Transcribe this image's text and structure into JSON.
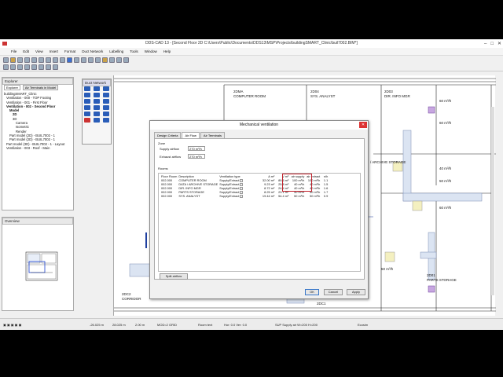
{
  "window": {
    "title": "DDS-CAD 13 - [Second Floor 2D C:\\Users\\Public\\Documents\\DDS13\\MSP\\Projects\\buildingSMART_Clinic\\buil7002.BIM*]",
    "minimize": "–",
    "maximize": "□",
    "close": "✕"
  },
  "menu": [
    "File",
    "Edit",
    "View",
    "Insert",
    "Format",
    "Duct Network",
    "Labelling",
    "Tools",
    "Window",
    "Help"
  ],
  "explorer": {
    "header": "Explorer",
    "tabs": [
      "Explorer",
      "Air Terminals in Model"
    ],
    "tree": [
      "buildingSMART_Clinic",
      "Ventilation - 000 - TOP Footing",
      "Ventilation - 001 - First Floor",
      "Ventilation - 002 - Second Floor",
      "Model",
      "2D",
      "3D",
      "Camera",
      "Isometric",
      "Render",
      "Part model (2D) - BUIL7002 - 1",
      "Part model (2D) - BUIL7002 - 1",
      "Part model (3D) - BUIL7002 - 1 - Layout",
      "Ventilation - 003 - Roof - Main"
    ]
  },
  "overview": {
    "header": "Overview"
  },
  "duct_network": {
    "header": "Duct Network"
  },
  "canvas_labels": [
    "2DMA",
    "COMPUTER ROOM",
    "2D04",
    "SYS. ANALYST",
    "2D03",
    "DIR. INFO MGR",
    "60 m³/h",
    "60 m³/h",
    "40 m³/h",
    "50 m³/h",
    "/ ARCHIVE STORAGE",
    "60 m³/h",
    "50 m³/h",
    "2D01",
    "PARTS STORAGE",
    "2DC2",
    "CORRIDOR",
    "2DC1"
  ],
  "dialog": {
    "title": "Mechanical ventilation",
    "close": "✕",
    "tabs": [
      "Design Criteria",
      "Air Flow",
      "Air Terminals"
    ],
    "active_tab": "Air Flow",
    "zone_label": "Zone",
    "supply_label": "Supply airflow",
    "supply_value": "270 m³/h",
    "exhaust_label": "Exhaust airflow",
    "exhaust_value": "270 m³/h",
    "rooms_label": "Rooms",
    "columns": [
      "Floor Room",
      "Description",
      "Ventilation type",
      "A m²",
      "V m³",
      "air supply",
      "air extract",
      "n/h"
    ],
    "rows": [
      [
        "002.000",
        "COMPUTER ROOM",
        "Supply/Extract",
        "32.00 m²",
        "89.6 m³",
        "100 m³/h",
        "100 m³/h",
        "1.1"
      ],
      [
        "002.000",
        "DATA / ARCHIVE STORAGE",
        "Supply/Extract",
        "9.23 m²",
        "25.8 m³",
        "40 m³/h",
        "40 m³/h",
        "1.5"
      ],
      [
        "002.000",
        "DIR. INFO MGR",
        "Supply/Extract",
        "8.72 m²",
        "24.4 m³",
        "40 m³/h",
        "40 m³/h",
        "1.6"
      ],
      [
        "002.000",
        "PARTS STORAGE",
        "Supply/Extract",
        "8.25 m²",
        "23.1 m³",
        "40 m³/h",
        "40 m³/h",
        "1.7"
      ],
      [
        "002.000",
        "SYS. ANALYST",
        "Supply/Extract",
        "19.44 m²",
        "54.4 m³",
        "50 m³/h",
        "50 m³/h",
        "0.9"
      ]
    ],
    "split_button": "Split airflow",
    "ok": "OK",
    "cancel": "Cancel",
    "apply": "Apply"
  },
  "status": {
    "x": "-26.025 m",
    "y": "28.025 m",
    "z": "2.00 m",
    "grid": "MOD=2 GRID",
    "room": "Room text",
    "hor": "Hor: 0.0 Ver: 0.0",
    "sup": "SUP Supply air W=200 H=200",
    "brand": "Ecosim"
  }
}
